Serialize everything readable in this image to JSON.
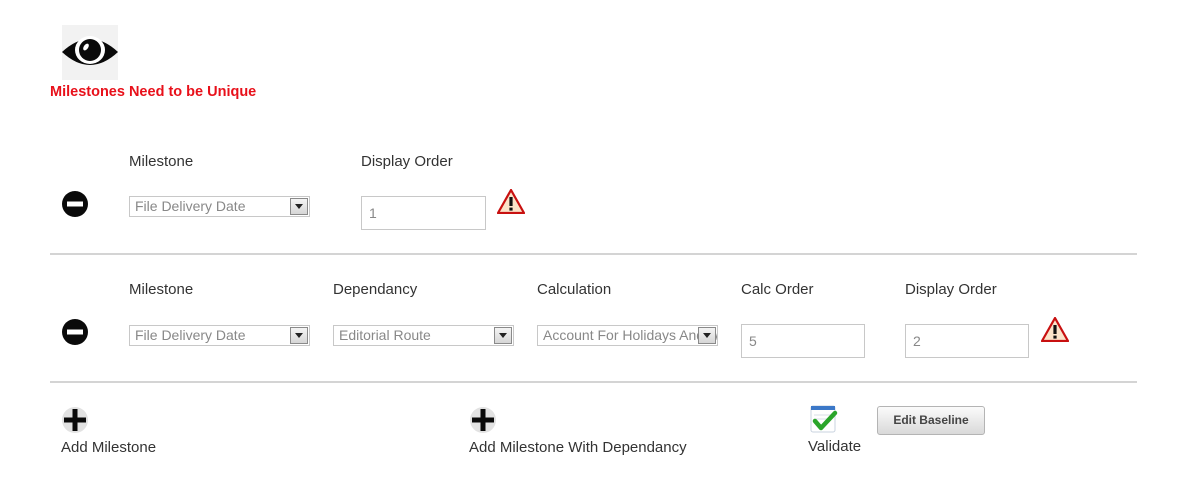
{
  "header": {
    "view_icon": "eye-icon",
    "error_message": "Milestones Need to be Unique",
    "error_color": "#e8101a"
  },
  "rows": [
    {
      "remove_icon": "minus-circle-icon",
      "milestone_label": "Milestone",
      "milestone_value": "File Delivery Date",
      "display_order_label": "Display Order",
      "display_order_value": "1",
      "warning_icon": "warning-triangle-icon"
    },
    {
      "remove_icon": "minus-circle-icon",
      "milestone_label": "Milestone",
      "milestone_value": "File Delivery Date",
      "dependancy_label": "Dependancy",
      "dependancy_value": "Editorial Route",
      "calculation_label": "Calculation",
      "calculation_value": "Account For Holidays And Weekends",
      "calc_order_label": "Calc Order",
      "calc_order_value": "5",
      "display_order_label": "Display Order",
      "display_order_value": "2",
      "warning_icon": "warning-triangle-icon"
    }
  ],
  "actions": {
    "add_milestone_label": "Add Milestone",
    "add_milestone_dep_label": "Add Milestone With Dependancy",
    "validate_label": "Validate",
    "edit_baseline_label": "Edit Baseline"
  }
}
